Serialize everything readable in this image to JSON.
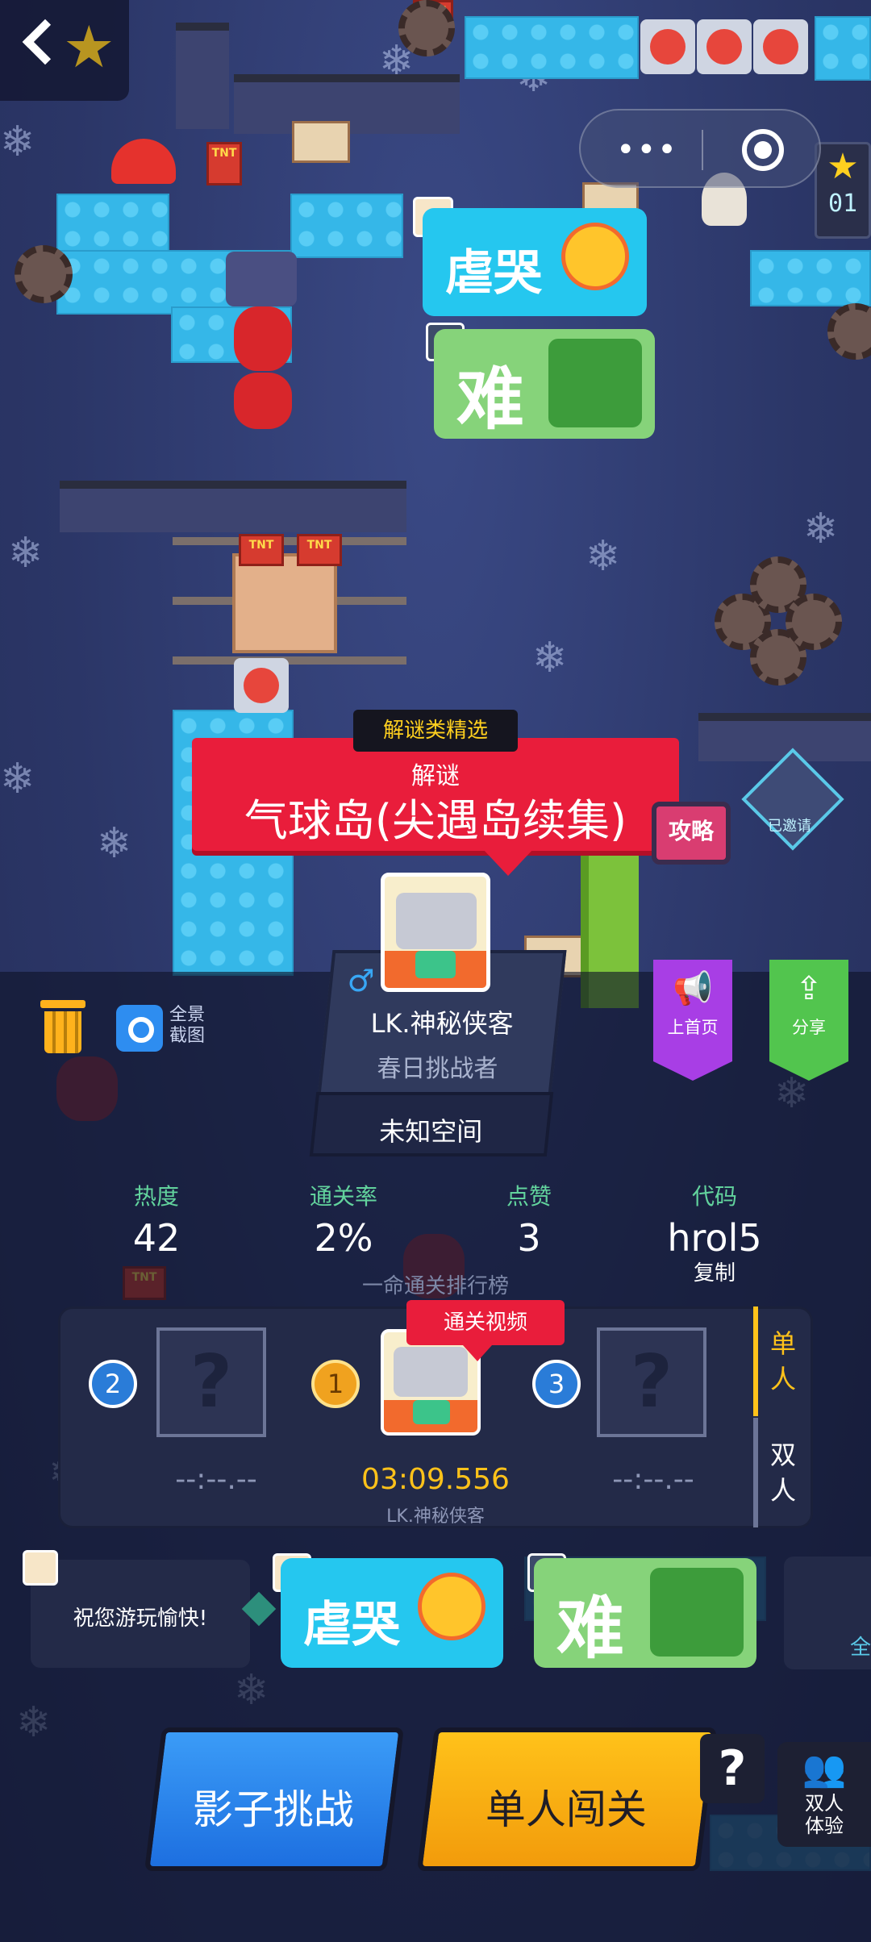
{
  "level": {
    "genre_tag": "解谜类精选",
    "category": "解谜",
    "title": "气球岛(尖遇岛续集)",
    "guide_label": "攻略",
    "invited_label": "已邀请"
  },
  "stickers": {
    "cry": "虐哭",
    "hard": "难"
  },
  "creator": {
    "gender_symbol": "♂",
    "name": "LK.神秘侠客",
    "title": "春日挑战者",
    "space": "未知空间"
  },
  "tools": {
    "screenshot_label": "全景截图",
    "promote_label": "上首页",
    "share_label": "分享"
  },
  "stats": [
    {
      "label": "热度",
      "value": "42"
    },
    {
      "label": "通关率",
      "value": "2%"
    },
    {
      "label": "点赞",
      "value": "3"
    },
    {
      "label": "代码",
      "value": "hrol5"
    }
  ],
  "copy_label": "复制",
  "ranking": {
    "title": "一命通关排行榜",
    "video_tag": "通关视频",
    "tabs": [
      "单人",
      "双人"
    ],
    "entries": [
      {
        "rank": "2",
        "time": "--:--.--",
        "name": ""
      },
      {
        "rank": "1",
        "time": "03:09.556",
        "name": "LK.神秘侠客"
      },
      {
        "rank": "3",
        "time": "--:--.--",
        "name": ""
      }
    ]
  },
  "comments": {
    "message": "祝您游玩愉快!",
    "more_label": "全"
  },
  "buttons": {
    "shadow": "影子挑战",
    "solo": "单人闯关",
    "help": "?",
    "duo": "双人体验"
  },
  "level_counter": "01",
  "colors": {
    "banner_red": "#e91d3b",
    "solo_yellow": "#ffc21a",
    "shadow_blue": "#1d6fe0",
    "promote_purple": "#a83ee5",
    "share_green": "#52c54e",
    "stat_label_green": "#62d39d"
  }
}
